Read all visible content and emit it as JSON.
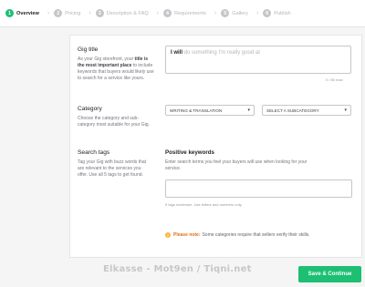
{
  "steps": [
    {
      "num": "1",
      "label": "Overview"
    },
    {
      "num": "2",
      "label": "Pricing"
    },
    {
      "num": "3",
      "label": "Description & FAQ"
    },
    {
      "num": "4",
      "label": "Requirements"
    },
    {
      "num": "5",
      "label": "Gallery"
    },
    {
      "num": "6",
      "label": "Publish"
    }
  ],
  "chevron": "›",
  "gig_title": {
    "label": "Gig title",
    "desc_pre": "As your Gig storefront, your ",
    "desc_bold": "title is the most important place",
    "desc_post": " to include keywords that buyers would likely use to search for a service like yours.",
    "prefix": "I will",
    "placeholder": "do something I'm really good at",
    "counter": "0 / 80 max"
  },
  "category": {
    "label": "Category",
    "desc": "Choose the category and sub-category most suitable for your Gig.",
    "selected": "WRITING & TRANSLATION",
    "sub_placeholder": "SELECT A SUBCATEGORY",
    "caret": "▾"
  },
  "search_tags": {
    "label": "Search tags",
    "desc": "Tag your Gig with buzz words that are relevant to the services you offer. Use all 5 tags to get found.",
    "kw_title": "Positive keywords",
    "kw_desc": "Enter search terms you feel your buyers will use when looking for your service.",
    "hint": "5 tags maximum. Use letters and numbers only."
  },
  "note": {
    "icon": "!",
    "prefix": "Please note:",
    "text": "Some categories require that sellers verify their skills."
  },
  "watermark": "Elkasse - Mot9en / Tiqni.net",
  "save_button": "Save & Continue",
  "colors": {
    "accent": "#1dbf73",
    "warning": "#e26c1a"
  }
}
